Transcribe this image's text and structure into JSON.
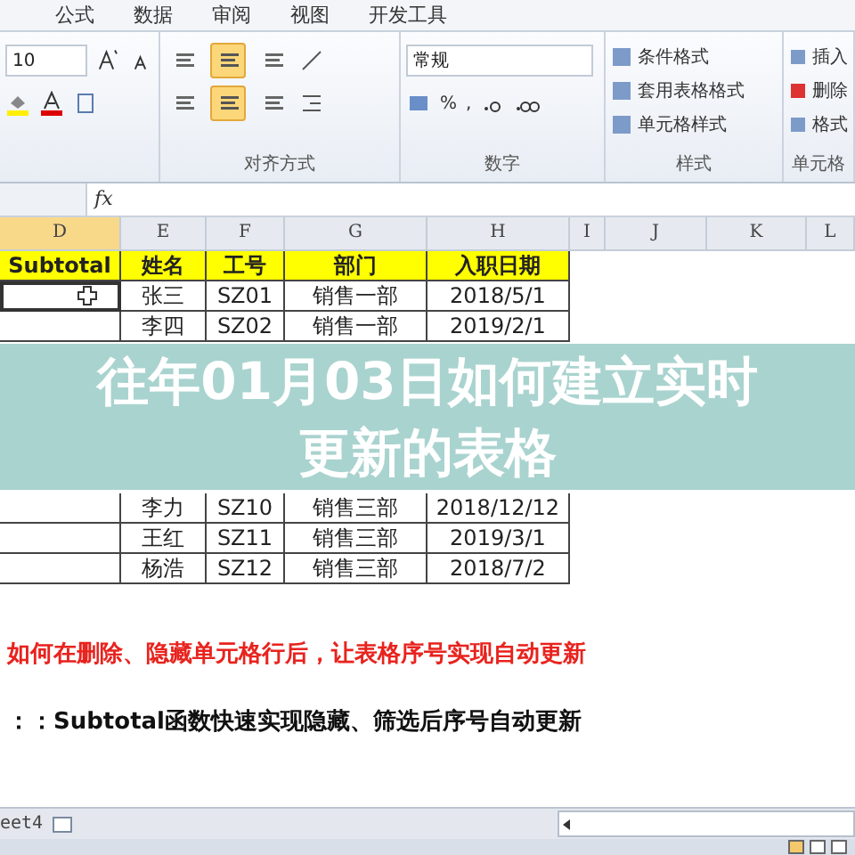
{
  "menu_tabs": [
    "公式",
    "数据",
    "审阅",
    "视图",
    "开发工具"
  ],
  "ribbon": {
    "font_size": "10",
    "vertical_align": [
      {
        "selected": false
      },
      {
        "selected": true
      },
      {
        "selected": false
      }
    ],
    "horizontal_align": [
      {
        "selected": false
      },
      {
        "selected": true
      },
      {
        "selected": false
      }
    ],
    "alignment_label": "对齐方式",
    "number_format": "常规",
    "percent": "%",
    "comma": ",",
    "number_label": "数字",
    "styles": [
      "条件格式",
      "套用表格格式",
      "单元格样式"
    ],
    "styles_label": "样式",
    "cells": [
      "插入",
      "删除",
      "格式"
    ],
    "cells_label": "单元格"
  },
  "formula_bar": {
    "function_label": "fx"
  },
  "sheet": {
    "columns": [
      "D",
      "E",
      "F",
      "G",
      "H",
      "I",
      "J",
      "K",
      "L"
    ],
    "header": [
      "Subtotal",
      "姓名",
      "工号",
      "部门",
      "入职日期"
    ],
    "rows_top": [
      {
        "selected": true,
        "name": "张三",
        "id": "SZ01",
        "dept": "销售一部",
        "date": "2018/5/1"
      },
      {
        "selected": false,
        "name": "李四",
        "id": "SZ02",
        "dept": "销售一部",
        "date": "2019/2/1"
      }
    ],
    "rows_bottom": [
      {
        "selected": false,
        "name": "李力",
        "id": "SZ10",
        "dept": "销售三部",
        "date": "2018/12/12"
      },
      {
        "selected": false,
        "name": "王红",
        "id": "SZ11",
        "dept": "销售三部",
        "date": "2019/3/1"
      },
      {
        "selected": false,
        "name": "杨浩",
        "id": "SZ12",
        "dept": "销售三部",
        "date": "2018/7/2"
      }
    ]
  },
  "banner": {
    "title": "往年01月03日如何建立实时更新的表格"
  },
  "notes": [
    {
      "kind": "heading",
      "text": "如何在删除、隐藏单元格行后，让表格序号实现自动更新"
    },
    {
      "kind": "tip",
      "text": "：：Subtotal函数快速实现隐藏、筛选后序号自动更新"
    }
  ],
  "sheet_tabs": [
    "eet4"
  ]
}
